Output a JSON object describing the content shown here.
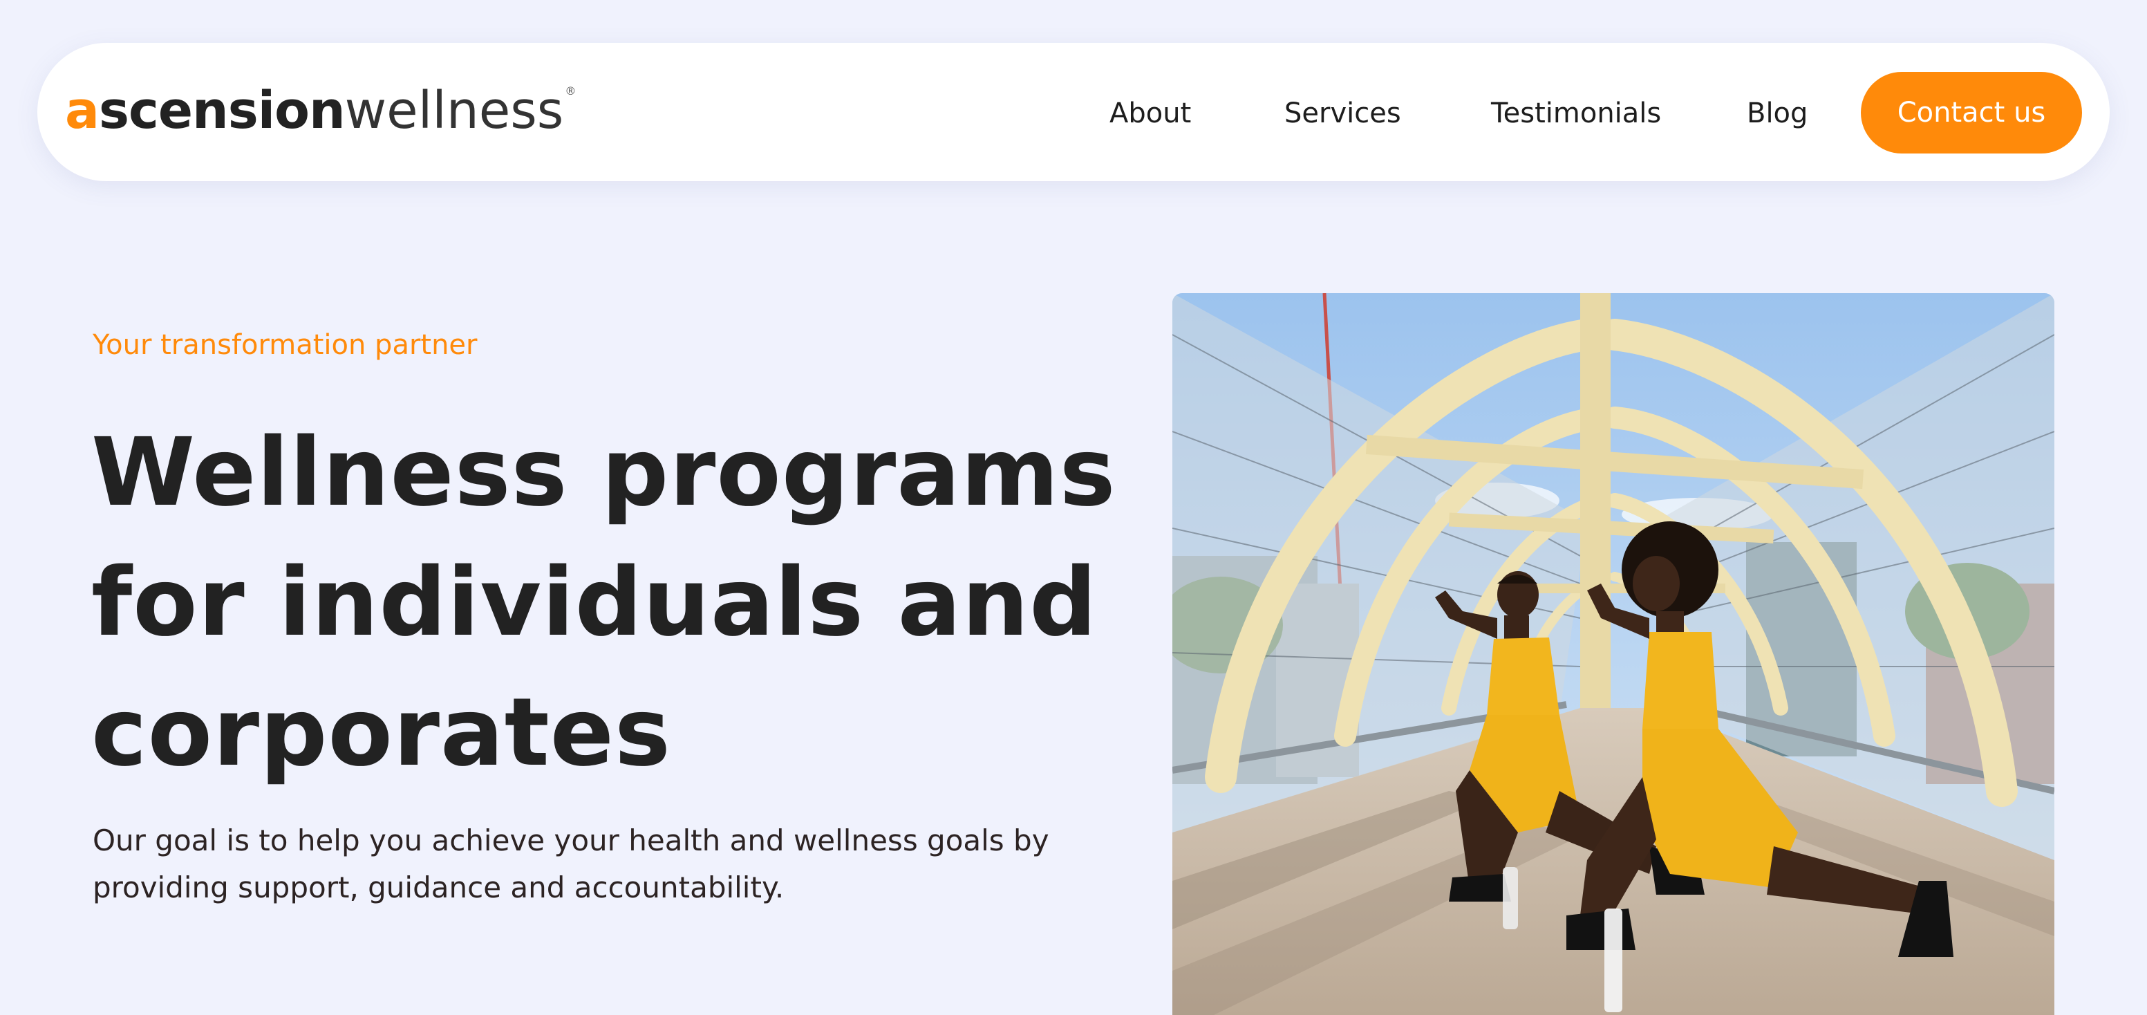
{
  "logo": {
    "first_letter": "a",
    "bold_part": "scension",
    "light_part": "wellness",
    "registered_mark": "®"
  },
  "nav": {
    "items": [
      {
        "label": "About"
      },
      {
        "label": "Services"
      },
      {
        "label": "Testimonials"
      },
      {
        "label": "Blog"
      }
    ],
    "cta_label": "Contact us"
  },
  "hero": {
    "eyebrow": "Your transformation partner",
    "title_lines": [
      "Wellness programs",
      "for individuals and",
      "corporates"
    ],
    "description_lines": [
      "Our goal is to help you achieve your health and wellness goals by",
      "providing support, guidance and accountability."
    ]
  },
  "colors": {
    "accent": "#ff8a0a",
    "page_background": "#f0f2fd",
    "heading": "#222222"
  }
}
